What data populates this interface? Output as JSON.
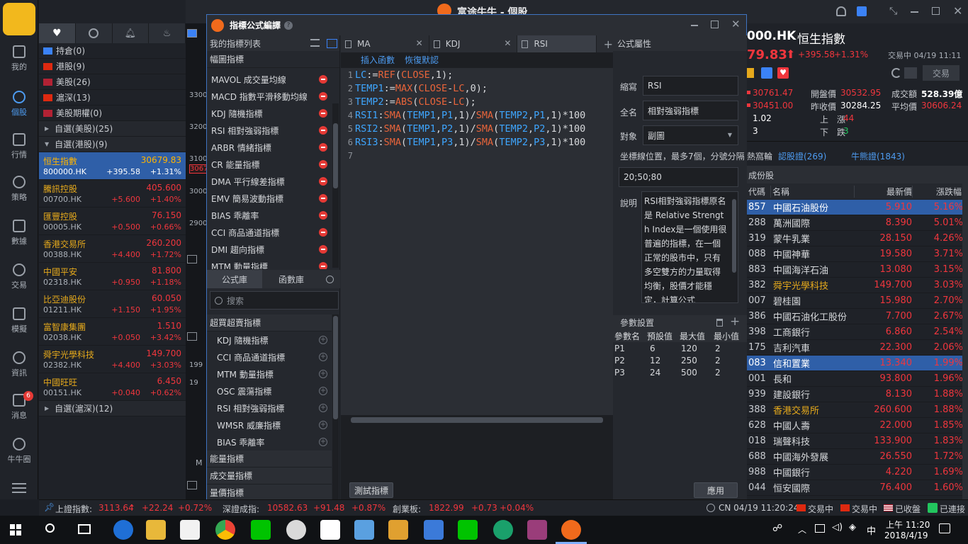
{
  "app": {
    "title": "富途牛牛 - 個股"
  },
  "nav": [
    {
      "label": "我的",
      "icon": "user-icon"
    },
    {
      "label": "個股",
      "icon": "stock-chart-icon",
      "active": true
    },
    {
      "label": "行情",
      "icon": "market-icon"
    },
    {
      "label": "策略",
      "icon": "bulb-icon"
    },
    {
      "label": "數據",
      "icon": "database-icon"
    },
    {
      "label": "交易",
      "icon": "trade-icon"
    },
    {
      "label": "模擬",
      "icon": "flask-icon"
    },
    {
      "label": "資訊",
      "icon": "news-icon"
    },
    {
      "label": "消息",
      "icon": "message-icon",
      "badge": "6"
    },
    {
      "label": "牛牛圈",
      "icon": "circle-icon"
    }
  ],
  "watchlist": {
    "groups": [
      {
        "label": "持倉(0)"
      },
      {
        "label": "港股(9)"
      },
      {
        "label": "美股(26)"
      },
      {
        "label": "滬深(13)"
      },
      {
        "label": "美股期權(0)"
      },
      {
        "label": "自選(美股)(25)"
      },
      {
        "label": "自選(港股)(9)"
      }
    ],
    "stocks": [
      {
        "name": "恒生指數",
        "code": "800000.HK",
        "price": "30679.83",
        "change": "+395.58",
        "pct": "+1.31%"
      },
      {
        "name": "騰訊控股",
        "code": "00700.HK",
        "price": "405.600",
        "change": "+5.600",
        "pct": "+1.40%"
      },
      {
        "name": "匯豐控股",
        "code": "00005.HK",
        "price": "76.150",
        "change": "+0.500",
        "pct": "+0.66%"
      },
      {
        "name": "香港交易所",
        "code": "00388.HK",
        "price": "260.200",
        "change": "+4.400",
        "pct": "+1.72%"
      },
      {
        "name": "中國平安",
        "code": "02318.HK",
        "price": "81.800",
        "change": "+0.950",
        "pct": "+1.18%"
      },
      {
        "name": "比亞迪股份",
        "code": "01211.HK",
        "price": "60.050",
        "change": "+1.150",
        "pct": "+1.95%"
      },
      {
        "name": "富智康集團",
        "code": "02038.HK",
        "price": "1.510",
        "change": "+0.050",
        "pct": "+3.42%"
      },
      {
        "name": "舜宇光學科技",
        "code": "02382.HK",
        "price": "149.700",
        "change": "+4.400",
        "pct": "+3.03%"
      },
      {
        "name": "中國旺旺",
        "code": "00151.HK",
        "price": "6.450",
        "change": "+0.040",
        "pct": "+0.62%"
      }
    ],
    "footer_group": "自選(滬深)(12)"
  },
  "chart_strip": {
    "ticks": [
      "3300",
      "3200",
      "3100",
      "3067",
      "3000",
      "2900",
      "199",
      "19"
    ],
    "m_label": "M"
  },
  "dialog": {
    "title": "指標公式編譯",
    "left_header": "我的指標列表",
    "section_main": "幅圖指標",
    "my_indicators": [
      "MAVOL 成交量均線",
      "MACD 指數平滑移動均線",
      "KDJ 隨機指標",
      "RSI 相對強弱指標",
      "ARBR 情緒指標",
      "CR 能量指標",
      "DMA 平行線差指標",
      "EMV 簡易波動指標",
      "BIAS 乖離率",
      "CCI 商品通道指標",
      "DMI 趨向指標",
      "MTM 動量指標"
    ],
    "lib_tabs": [
      "公式庫",
      "函數庫"
    ],
    "search_placeholder": "搜索",
    "lib_group": "超買超賣指標",
    "lib_items": [
      "KDJ 隨機指標",
      "CCI 商品通道指標",
      "MTM 動量指標",
      "OSC 震蕩指標",
      "RSI 相對強弱指標",
      "WMSR 威廉指標",
      "BIAS 乖離率"
    ],
    "lib_groups_after": [
      "能量指標",
      "成交量指標",
      "量價指標"
    ],
    "editor_tabs": [
      "MA",
      "KDJ",
      "RSI"
    ],
    "toolbar": {
      "insert": "插入函數",
      "restore": "恢復默認"
    },
    "code": [
      [
        [
          "v",
          "LC"
        ],
        [
          "o",
          ":="
        ],
        [
          "f",
          "REF"
        ],
        [
          "o",
          "("
        ],
        [
          "f",
          "CLOSE"
        ],
        [
          "o",
          ","
        ],
        [
          "n",
          "1"
        ],
        [
          "o",
          ");"
        ]
      ],
      [
        [
          "v",
          "TEMP1"
        ],
        [
          "o",
          ":="
        ],
        [
          "f",
          "MAX"
        ],
        [
          "o",
          "("
        ],
        [
          "f",
          "CLOSE"
        ],
        [
          "o",
          "-"
        ],
        [
          "f",
          "LC"
        ],
        [
          "o",
          ","
        ],
        [
          "n",
          "0"
        ],
        [
          "o",
          ");"
        ]
      ],
      [
        [
          "v",
          "TEMP2"
        ],
        [
          "o",
          ":="
        ],
        [
          "f",
          "ABS"
        ],
        [
          "o",
          "("
        ],
        [
          "f",
          "CLOSE"
        ],
        [
          "o",
          "-"
        ],
        [
          "f",
          "LC"
        ],
        [
          "o",
          ");"
        ]
      ],
      [
        [
          "v",
          "RSI1"
        ],
        [
          "o",
          ":"
        ],
        [
          "f",
          "SMA"
        ],
        [
          "o",
          "("
        ],
        [
          "v",
          "TEMP1"
        ],
        [
          "o",
          ","
        ],
        [
          "v",
          "P1"
        ],
        [
          "o",
          ","
        ],
        [
          "n",
          "1"
        ],
        [
          "o",
          ")/"
        ],
        [
          "f",
          "SMA"
        ],
        [
          "o",
          "("
        ],
        [
          "v",
          "TEMP2"
        ],
        [
          "o",
          ","
        ],
        [
          "v",
          "P1"
        ],
        [
          "o",
          ","
        ],
        [
          "n",
          "1"
        ],
        [
          "o",
          ")*"
        ],
        [
          "n",
          "100"
        ]
      ],
      [
        [
          "v",
          "RSI2"
        ],
        [
          "o",
          ":"
        ],
        [
          "f",
          "SMA"
        ],
        [
          "o",
          "("
        ],
        [
          "v",
          "TEMP1"
        ],
        [
          "o",
          ","
        ],
        [
          "v",
          "P2"
        ],
        [
          "o",
          ","
        ],
        [
          "n",
          "1"
        ],
        [
          "o",
          ")/"
        ],
        [
          "f",
          "SMA"
        ],
        [
          "o",
          "("
        ],
        [
          "v",
          "TEMP2"
        ],
        [
          "o",
          ","
        ],
        [
          "v",
          "P2"
        ],
        [
          "o",
          ","
        ],
        [
          "n",
          "1"
        ],
        [
          "o",
          ")*"
        ],
        [
          "n",
          "100"
        ]
      ],
      [
        [
          "v",
          "RSI3"
        ],
        [
          "o",
          ":"
        ],
        [
          "f",
          "SMA"
        ],
        [
          "o",
          "("
        ],
        [
          "v",
          "TEMP1"
        ],
        [
          "o",
          ","
        ],
        [
          "v",
          "P3"
        ],
        [
          "o",
          ","
        ],
        [
          "n",
          "1"
        ],
        [
          "o",
          ")/"
        ],
        [
          "f",
          "SMA"
        ],
        [
          "o",
          "("
        ],
        [
          "v",
          "TEMP2"
        ],
        [
          "o",
          ","
        ],
        [
          "v",
          "P3"
        ],
        [
          "o",
          ","
        ],
        [
          "n",
          "1"
        ],
        [
          "o",
          ")*"
        ],
        [
          "n",
          "100"
        ]
      ],
      []
    ],
    "props": {
      "header": "公式屬性",
      "abbr_label": "縮寫",
      "abbr_value": "RSI",
      "full_label": "全名",
      "full_value": "相對強弱指標",
      "target_label": "對象",
      "target_value": "副圖",
      "axis_hint": "坐標線位置，最多7個，分號分隔",
      "axis_value": "20;50;80",
      "desc_label": "說明",
      "desc_value": "RSI相對強弱指標原名是 Relative Strength Index是一個使用很普遍的指標，在一個正常的股市中，只有多空雙方的力量取得均衡，股價才能穩定，計算公式"
    },
    "params": {
      "header": "參數設置",
      "cols": [
        "參數名",
        "預設值",
        "最大值",
        "最小值"
      ],
      "rows": [
        [
          "P1",
          "6",
          "120",
          "2"
        ],
        [
          "P2",
          "12",
          "250",
          "2"
        ],
        [
          "P3",
          "24",
          "500",
          "2"
        ]
      ]
    },
    "test_button": "測試指標",
    "apply_button": "應用"
  },
  "quote": {
    "code": "000.HK",
    "name": "恒生指數",
    "price": "79.83",
    "change": "+395.58",
    "pct": "+1.31%",
    "status": "交易中 04/19 11:11",
    "trade_btn": "交易",
    "high": "30761.47",
    "low": "30451.00",
    "open_label": "開盤價",
    "open": "30532.95",
    "prev_label": "昨收價",
    "prev": "30284.25",
    "vol_label": "成交額",
    "vol": "528.39億",
    "avg_label": "平均價",
    "avg": "30606.24",
    "r1": "1.02",
    "up_label": "上　漲",
    "up": "44",
    "r2": "3",
    "down_label": "下　跌",
    "down": "3",
    "links": [
      "熱窩輪",
      "認股證(269)",
      "牛熊證(1843)"
    ],
    "section": "成份股",
    "cols": [
      "代碼",
      "名稱",
      "最新價",
      "漲跌幅"
    ],
    "rows": [
      [
        "857",
        "中國石油股份",
        "5.910",
        "5.16%"
      ],
      [
        "288",
        "萬洲國際",
        "8.390",
        "5.01%"
      ],
      [
        "319",
        "蒙牛乳業",
        "28.150",
        "4.26%"
      ],
      [
        "088",
        "中國神華",
        "19.580",
        "3.71%"
      ],
      [
        "883",
        "中國海洋石油",
        "13.080",
        "3.15%"
      ],
      [
        "382",
        "舜宇光學科技",
        "149.700",
        "3.03%"
      ],
      [
        "007",
        "碧桂園",
        "15.980",
        "2.70%"
      ],
      [
        "386",
        "中國石油化工股份",
        "7.700",
        "2.67%"
      ],
      [
        "398",
        "工商銀行",
        "6.860",
        "2.54%"
      ],
      [
        "175",
        "吉利汽車",
        "22.300",
        "2.06%"
      ],
      [
        "083",
        "信和置業",
        "13.340",
        "1.99%"
      ],
      [
        "001",
        "長和",
        "93.800",
        "1.96%"
      ],
      [
        "939",
        "建設銀行",
        "8.130",
        "1.88%"
      ],
      [
        "388",
        "香港交易所",
        "260.600",
        "1.88%"
      ],
      [
        "628",
        "中國人壽",
        "22.000",
        "1.85%"
      ],
      [
        "018",
        "瑞聲科技",
        "133.900",
        "1.83%"
      ],
      [
        "688",
        "中國海外發展",
        "26.550",
        "1.72%"
      ],
      [
        "988",
        "中國銀行",
        "4.220",
        "1.69%"
      ],
      [
        "044",
        "恒安國際",
        "76.400",
        "1.60%"
      ]
    ]
  },
  "statusbar": {
    "sh_label": "上證指數:",
    "sh": "3113.64",
    "sh_up": "↑",
    "sh_ch": "+22.24",
    "sh_pct": "+0.72%",
    "sz_label": "深證成指:",
    "sz": "10582.63",
    "sz_ch": "+91.48",
    "sz_pct": "+0.87%",
    "cy_label": "創業板:",
    "cy": "1822.99",
    "cy_ch": "+0.73",
    "cy_pct": "+0.04%",
    "time": "CN 04/19 11:20:24",
    "m1": "交易中",
    "m2": "交易中",
    "m3": "已收盤",
    "m4": "已連接"
  },
  "taskbar": {
    "time": "上午 11:20",
    "date": "2018/4/19",
    "ime": "中"
  },
  "colors": {
    "accent": "#2f5fa8",
    "up": "#f0363d",
    "gold": "#e5a91c"
  }
}
